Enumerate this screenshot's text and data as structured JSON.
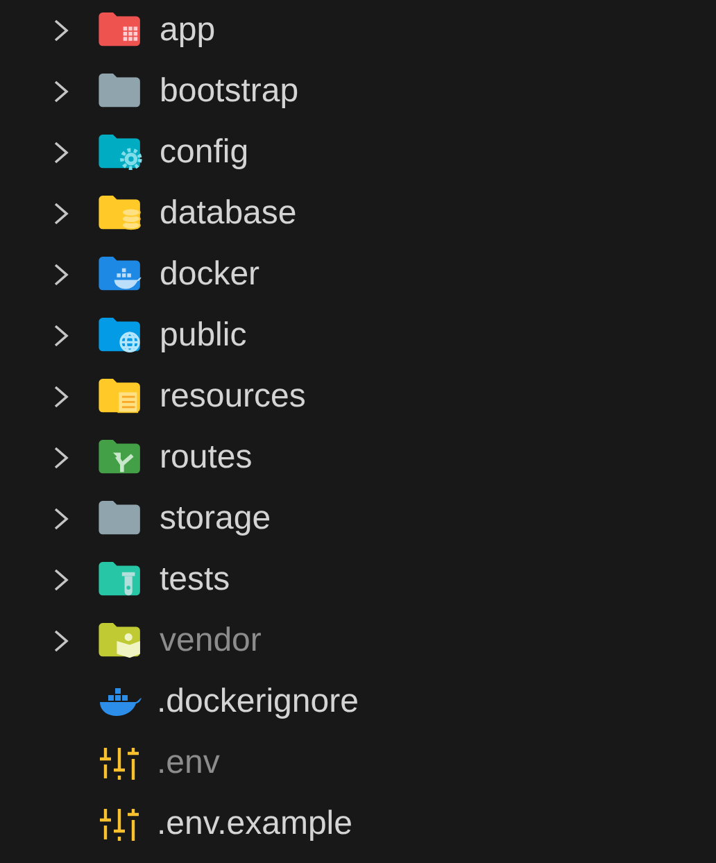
{
  "items": [
    {
      "kind": "gridfolder",
      "name": "app",
      "expanded": false,
      "ignored": false
    },
    {
      "kind": "folder",
      "name": "bootstrap",
      "expanded": false,
      "ignored": false
    },
    {
      "kind": "gearfolder",
      "name": "config",
      "expanded": false,
      "ignored": false
    },
    {
      "kind": "databasefolder",
      "name": "database",
      "expanded": false,
      "ignored": false
    },
    {
      "kind": "whalefolder",
      "name": "docker",
      "expanded": false,
      "ignored": false
    },
    {
      "kind": "globefolder",
      "name": "public",
      "expanded": false,
      "ignored": false
    },
    {
      "kind": "documentfolder",
      "name": "resources",
      "expanded": false,
      "ignored": false
    },
    {
      "kind": "arrowfolder",
      "name": "routes",
      "expanded": false,
      "ignored": false
    },
    {
      "kind": "folder",
      "name": "storage",
      "expanded": false,
      "ignored": false
    },
    {
      "kind": "tubefolder",
      "name": "tests",
      "expanded": false,
      "ignored": false
    },
    {
      "kind": "packagefolder",
      "name": "vendor",
      "expanded": false,
      "ignored": true
    },
    {
      "kind": "whalefile",
      "name": ".dockerignore",
      "ignored": false
    },
    {
      "kind": "slidersfile",
      "name": ".env",
      "ignored": true
    },
    {
      "kind": "slidersfile",
      "name": ".env.example",
      "ignored": false
    }
  ]
}
